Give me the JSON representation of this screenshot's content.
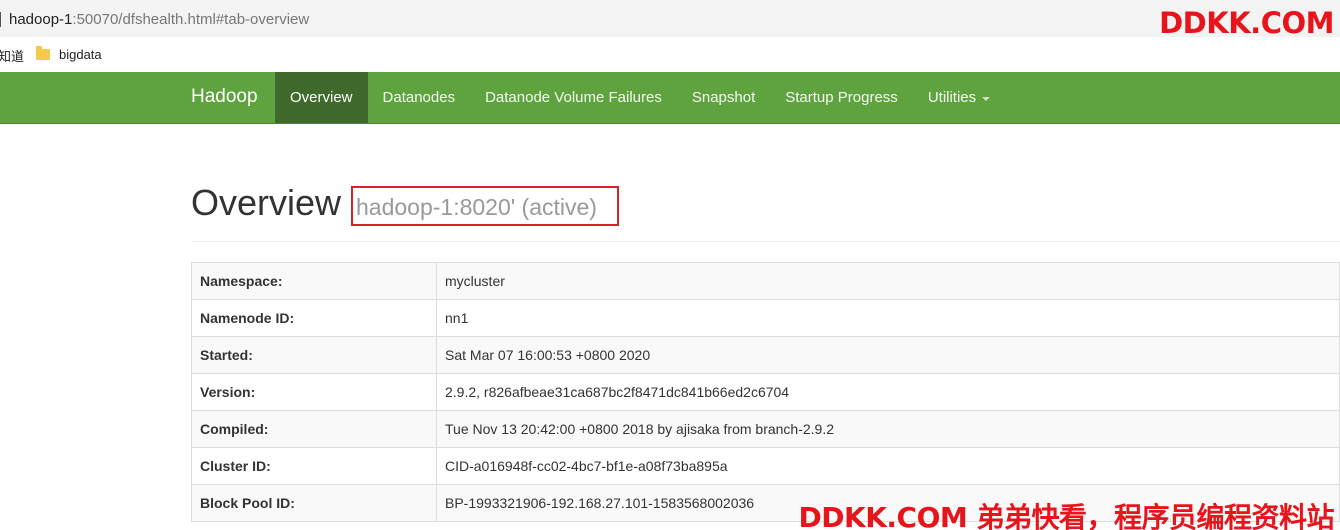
{
  "browser": {
    "url_host": "hadoop-1",
    "url_rest": ":50070/dfshealth.html#tab-overview",
    "bookmark_fragment": "知道",
    "bookmark_folder": "bigdata"
  },
  "watermark": {
    "top": "DDKK.COM",
    "bottom": "DDKK.COM 弟弟快看，程序员编程资料站",
    "color": "#e8141b"
  },
  "navbar": {
    "brand": "Hadoop",
    "color": "#5fa33e",
    "active_color": "#3f6a2b",
    "items": [
      {
        "label": "Overview",
        "active": true
      },
      {
        "label": "Datanodes",
        "active": false
      },
      {
        "label": "Datanode Volume Failures",
        "active": false
      },
      {
        "label": "Snapshot",
        "active": false
      },
      {
        "label": "Startup Progress",
        "active": false
      },
      {
        "label": "Utilities",
        "active": false,
        "dropdown": true
      }
    ]
  },
  "header": {
    "title": "Overview",
    "subtitle": "hadoop-1:8020' (active)"
  },
  "overview": {
    "rows": [
      {
        "key": "Namespace:",
        "value": "mycluster"
      },
      {
        "key": "Namenode ID:",
        "value": "nn1"
      },
      {
        "key": "Started:",
        "value": "Sat Mar 07 16:00:53 +0800 2020"
      },
      {
        "key": "Version:",
        "value": "2.9.2, r826afbeae31ca687bc2f8471dc841b66ed2c6704"
      },
      {
        "key": "Compiled:",
        "value": "Tue Nov 13 20:42:00 +0800 2018 by ajisaka from branch-2.9.2"
      },
      {
        "key": "Cluster ID:",
        "value": "CID-a016948f-cc02-4bc7-bf1e-a08f73ba895a"
      },
      {
        "key": "Block Pool ID:",
        "value": "BP-1993321906-192.168.27.101-1583568002036"
      }
    ]
  }
}
